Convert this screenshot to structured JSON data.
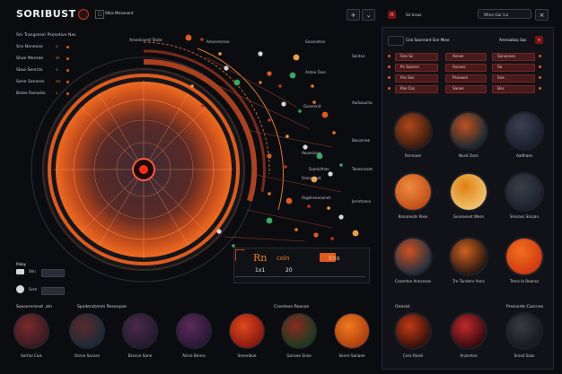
{
  "app": {
    "title": "SORIBUST",
    "header_label": "Sttia Mesanent",
    "add_label": "+",
    "chevron": "⌄"
  },
  "right_header": {
    "label": "Sir Icsus",
    "search_label": "Wtne Gar Ica"
  },
  "left_list": {
    "heading": "Sm Trangreser Psesetive Nas",
    "items": [
      {
        "label": "Sns Neneose",
        "value": "v"
      },
      {
        "label": "Shoe Mernde",
        "value": "st"
      },
      {
        "label": "Sbse Senrsts",
        "value": "v"
      },
      {
        "label": "Sene Soneres",
        "value": "se"
      },
      {
        "label": "Bstes Ranosto",
        "value": "v"
      }
    ]
  },
  "orbit_labels": [
    "Amenkioret Stote",
    "Amsorecsno",
    "Sosanetne",
    "Anteo Tose",
    "Sentse",
    "Aarboucha",
    "Gssemnit",
    "Aeuesione",
    "Bonarnee",
    "Ssanicthes",
    "Tesesnoset",
    "Ssanconet",
    "Asgelnsionanet",
    "Jerrstonco"
  ],
  "stats": {
    "value_a": "Rn",
    "value_b": "coln",
    "code": "Ens",
    "count_a": "1x1",
    "count_b": "20"
  },
  "side_ctrl": {
    "label": "Paloy",
    "row_a": "Shn",
    "row_b": "Ssre"
  },
  "bottom_section": {
    "title": "Sexsernrenst .stn",
    "subtitle": "Spsdenstenm Resenpse",
    "right_title": "Csontesn Reasan"
  },
  "bottom_planets": [
    {
      "label": "Sertiol Cais",
      "colors": [
        "#3a1a22",
        "#7a2a2a"
      ]
    },
    {
      "label": "Oarse Sacses",
      "colors": [
        "#1e2a38",
        "#5a2a2a"
      ]
    },
    {
      "label": "Bsssne Sane",
      "colors": [
        "#241a30",
        "#4a2a48"
      ]
    },
    {
      "label": "Alsne Benns",
      "colors": [
        "#2a1838",
        "#5a2a58"
      ]
    },
    {
      "label": "Senenboe",
      "colors": [
        "#8a1a10",
        "#e0481c"
      ]
    },
    {
      "label": "Gonsee Snoe",
      "colors": [
        "#1e3a20",
        "#8a2a20"
      ]
    },
    {
      "label": "Senre Sanaee",
      "colors": [
        "#b04010",
        "#f07a20"
      ]
    }
  ],
  "right_panel": {
    "title": "Cnk Sannrant Ssn Miee",
    "action": "Amnsabsa Sas",
    "rows": [
      {
        "a": "Sne Ss",
        "b": "Asnes",
        "c": "Sansones"
      },
      {
        "a": "Ps Sassne",
        "b": "Asnsso",
        "c": "Sa"
      },
      {
        "a": "Pss Ses",
        "b": "Pssnoen",
        "c": "Sne"
      },
      {
        "a": "Pas Oss",
        "b": "Sanes",
        "c": "Bns"
      }
    ],
    "planets": [
      {
        "label": "Rsnnoee",
        "colors": [
          "#3a1a10",
          "#b04818"
        ]
      },
      {
        "label": "Nosd Ossn",
        "colors": [
          "#1a2a30",
          "#c05020"
        ]
      },
      {
        "label": "Aadhase",
        "colors": [
          "#1a2030",
          "#3a4050"
        ]
      },
      {
        "label": "Bsnoresds Pose",
        "colors": [
          "#c05018",
          "#f08a40"
        ]
      },
      {
        "label": "Gonsesset Wesn",
        "colors": [
          "#f0c070",
          "#e08010"
        ]
      },
      {
        "label": "Srenass Ssssan",
        "colors": [
          "#1e2230",
          "#3a3e48"
        ]
      },
      {
        "label": "Csoentse Anosnses",
        "colors": [
          "#223040",
          "#d05020"
        ]
      },
      {
        "label": "Tre Tundenr Asns",
        "colors": [
          "#2a1810",
          "#d06020"
        ]
      },
      {
        "label": "Trens Ia Reanss",
        "colors": [
          "#d03a10",
          "#f07020"
        ]
      }
    ],
    "bottom_labels": [
      "Onesot",
      "Prsssorte Csscnse"
    ],
    "bottom_planets": [
      {
        "label": "Csns Rosel",
        "colors": [
          "#3a1008",
          "#c03a18"
        ]
      },
      {
        "label": "Anzentse",
        "colors": [
          "#3a0a10",
          "#c02a2a"
        ]
      },
      {
        "label": "Srosd Saas",
        "colors": [
          "#181a20",
          "#3a3a40"
        ]
      }
    ]
  },
  "accent_colors": {
    "orange": "#f06a20",
    "red": "#d0302a",
    "dark": "#0b0c10"
  }
}
